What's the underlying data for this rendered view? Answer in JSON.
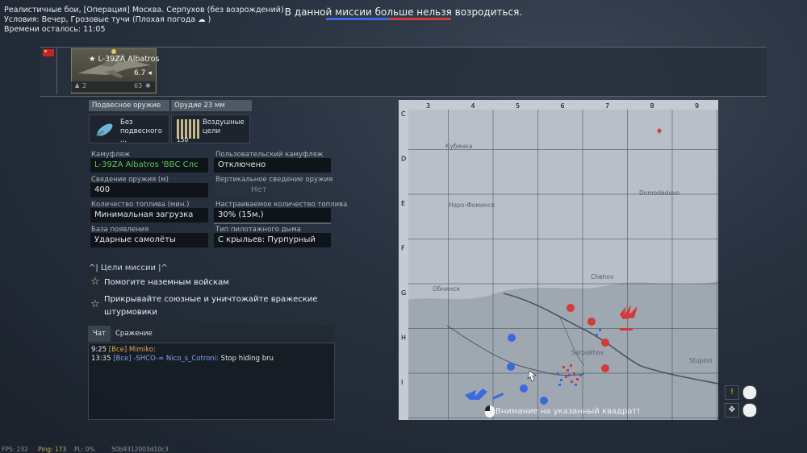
{
  "header": {
    "battle_mode": "Реалистичные бои, [Операция] Москва. Серпухов (без возрождений)",
    "conditions_label": "Условия:",
    "conditions_value": "Вечер, Грозовые тучи",
    "weather_note": "(Плохая погода",
    "weather_close": ")",
    "time_left_label": "Времени осталось:",
    "time_left_value": "11:05",
    "banner": "В данной миссии больше нельзя возродиться."
  },
  "aircraft": {
    "name": "L-39ZA Albatros",
    "battle_rating": "6.7",
    "crew_count": "2",
    "cost": "63"
  },
  "weapons": {
    "tab_suspended": "Подвесное оружие",
    "tab_cannon": "Орудие 23 мм",
    "suspended_value": "Без подвесного ...",
    "suspended_line1": "Без",
    "suspended_line2": "подвесного ...",
    "cannon_line1": "Воздушные",
    "cannon_line2": "цели",
    "cannon_ammo": "150"
  },
  "settings": {
    "camo_label": "Камуфляж",
    "camo_value": "L-39ZA Albatros 'ВВС Слс",
    "custom_camo_label": "Пользовательский камуфляж",
    "custom_camo_value": "Отключено",
    "convergence_label": "Сведение оружия (м)",
    "convergence_value": "400",
    "vert_convergence_label": "Вертикальное сведение оружия",
    "vert_convergence_value": "Нет",
    "fuel_label": "Количество топлива (мин.)",
    "fuel_value": "Минимальная загрузка",
    "custom_fuel_label": "Настраиваемое количество топлива",
    "custom_fuel_value": "30% (15м.)",
    "spawn_label": "База появления",
    "spawn_value": "Ударные самолёты",
    "smoke_label": "Тип пилотажного дыма",
    "smoke_value": "С крыльев: Пурпурный"
  },
  "objectives": {
    "title": "^| Цели миссии |^",
    "items": [
      "Помогите наземным войскам",
      "Прикрывайте союзные и уничтожайте вражеские",
      "штурмовики"
    ]
  },
  "chat": {
    "tab_chat": "Чат",
    "tab_battle": "Сражение",
    "messages": [
      {
        "time": "9:25",
        "channel": "[Все]",
        "user": "Mimiko:",
        "text": ""
      },
      {
        "time": "13:35",
        "channel": "[Все]",
        "user": "-SHCO-∞ Nico_s_Cotroni:",
        "text": "Stop hiding bru"
      }
    ]
  },
  "map": {
    "columns": [
      "3",
      "4",
      "5",
      "6",
      "7",
      "8",
      "9"
    ],
    "rows": [
      "C",
      "D",
      "E",
      "F",
      "G",
      "H",
      "I"
    ],
    "towns": [
      "Кубинка",
      "Наро-Фоминск",
      "Domodedovo",
      "Обнинск",
      "Chehov",
      "Serpukhov",
      "Stupino"
    ],
    "warning": "Внимание на указанный квадрат!"
  },
  "footer": {
    "fps": "FPS: 232",
    "ping": "Ping: 173",
    "pl": "PL: 0%",
    "session": "50b9312003d10c3"
  },
  "colors": {
    "ally": "#3b6ae0",
    "enemy": "#d33a3a",
    "camo_green": "#58c85a"
  }
}
